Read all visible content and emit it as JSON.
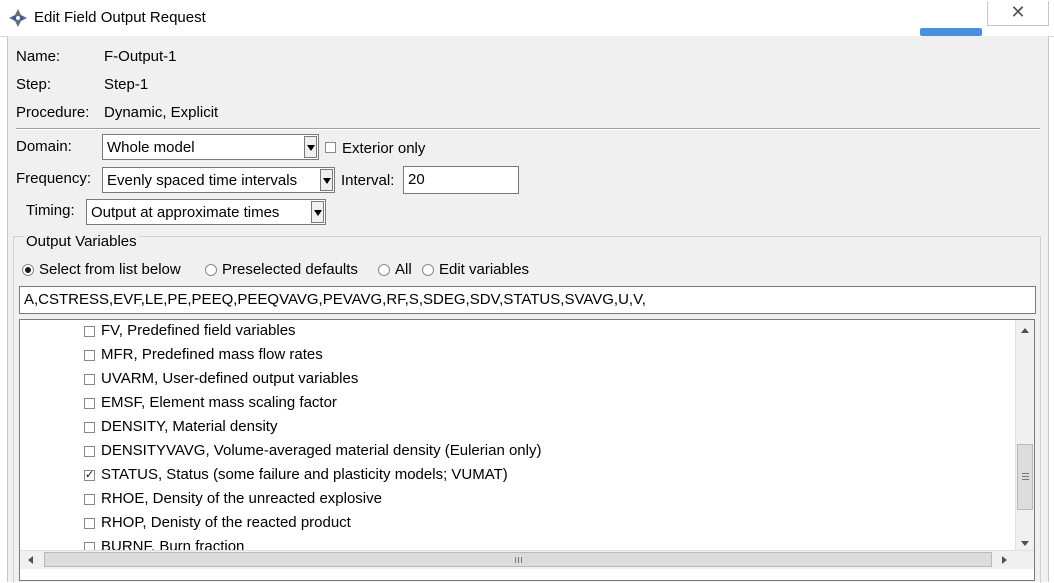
{
  "window": {
    "title": "Edit Field Output Request",
    "close_icon": "close-icon",
    "app_icon": "abaqus-icon"
  },
  "info": {
    "name_label": "Name:",
    "name_value": "F-Output-1",
    "step_label": "Step:",
    "step_value": "Step-1",
    "procedure_label": "Procedure:",
    "procedure_value": "Dynamic, Explicit"
  },
  "domain": {
    "label": "Domain:",
    "value": "Whole model",
    "exterior_only_label": "Exterior only",
    "exterior_only_checked": false
  },
  "frequency": {
    "label": "Frequency:",
    "value": "Evenly spaced time intervals",
    "interval_label": "Interval:",
    "interval_value": "20"
  },
  "timing": {
    "label": "Timing:",
    "value": "Output at approximate times"
  },
  "output_variables": {
    "group_label": "Output Variables",
    "options": [
      {
        "label": "Select from list below",
        "selected": true
      },
      {
        "label": "Preselected defaults",
        "selected": false
      },
      {
        "label": "All",
        "selected": false
      },
      {
        "label": "Edit variables",
        "selected": false
      }
    ],
    "variables_text": "A,CSTRESS,EVF,LE,PE,PEEQ,PEEQVAVG,PEVAVG,RF,S,SDEG,SDV,STATUS,SVAVG,U,V,",
    "list": [
      {
        "label": "FV, Predefined field variables",
        "checked": false
      },
      {
        "label": "MFR, Predefined mass flow rates",
        "checked": false
      },
      {
        "label": "UVARM, User-defined output variables",
        "checked": false
      },
      {
        "label": "EMSF, Element mass scaling factor",
        "checked": false
      },
      {
        "label": "DENSITY, Material density",
        "checked": false
      },
      {
        "label": "DENSITYVAVG, Volume-averaged material density (Eulerian only)",
        "checked": false
      },
      {
        "label": "STATUS, Status (some failure and plasticity models; VUMAT)",
        "checked": true
      },
      {
        "label": "RHOE, Density of the unreacted explosive",
        "checked": false
      },
      {
        "label": "RHOP, Denisty of the reacted product",
        "checked": false
      },
      {
        "label": "BURNF, Burn fraction",
        "checked": false
      }
    ]
  }
}
